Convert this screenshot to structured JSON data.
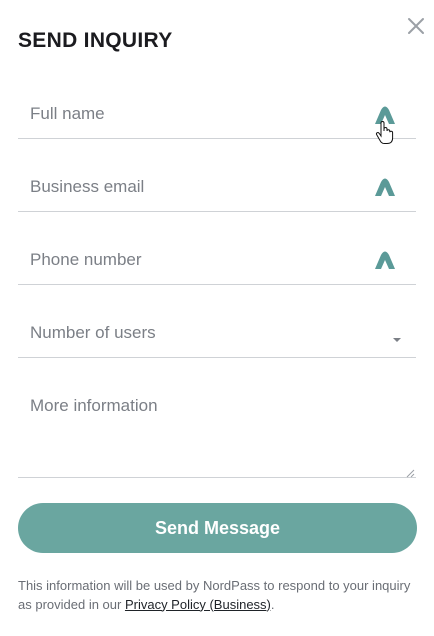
{
  "dialog": {
    "title": "SEND INQUIRY",
    "close_icon": "close-icon"
  },
  "form": {
    "full_name": {
      "placeholder": "Full name",
      "icon": "nordpass-autofill-icon"
    },
    "business_email": {
      "placeholder": "Business email",
      "icon": "nordpass-autofill-icon"
    },
    "phone_number": {
      "placeholder": "Phone number",
      "icon": "nordpass-autofill-icon"
    },
    "number_of_users": {
      "placeholder": "Number of users",
      "icon": "caret-down-icon"
    },
    "more_information": {
      "placeholder": "More information"
    },
    "submit_label": "Send Message"
  },
  "disclaimer": {
    "text": "This information will be used by NordPass to respond to your inquiry as provided in our ",
    "link_text": "Privacy Policy (Business)",
    "suffix": "."
  },
  "colors": {
    "accent": "#6aa6a0",
    "autofill_icon": "#5b9a98",
    "title": "#1b1b1f",
    "placeholder": "#7b7f86",
    "divider": "#cfd2d6"
  }
}
